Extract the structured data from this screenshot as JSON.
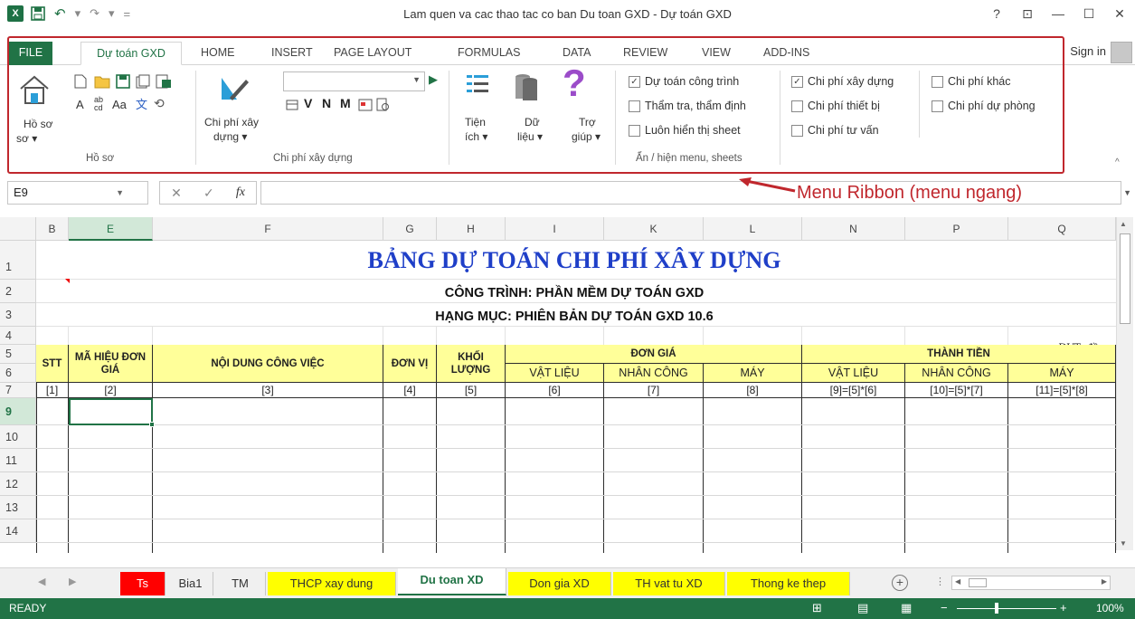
{
  "window": {
    "title": "Lam quen va cac thao tac co ban Du toan GXD - Dự toán GXD",
    "help": "?",
    "controls": [
      "⊡",
      "—",
      "☐",
      "✕"
    ]
  },
  "tabs": {
    "file": "FILE",
    "items": [
      "Dự toán GXD",
      "HOME",
      "INSERT",
      "PAGE LAYOUT",
      "FORMULAS",
      "DATA",
      "REVIEW",
      "VIEW",
      "ADD-INS"
    ],
    "sign_in": "Sign in"
  },
  "ribbon": {
    "hoso": {
      "btn": "Hồ sơ",
      "group": "Hồ sơ"
    },
    "cpxd": {
      "btn1": "Chi phí xây",
      "btn2": "dựng",
      "group": "Chi phí xây dựng"
    },
    "letters": [
      "V",
      "N",
      "M"
    ],
    "tienich": {
      "l1": "Tiện",
      "l2": "ích"
    },
    "dulieu": {
      "l1": "Dữ",
      "l2": "liệu"
    },
    "trogiup": {
      "l1": "Trợ",
      "l2": "giúp"
    },
    "checks": [
      {
        "label": "Dự toán công trình",
        "checked": true
      },
      {
        "label": "Thẩm tra, thẩm định",
        "checked": false
      },
      {
        "label": "Luôn hiển thị sheet",
        "checked": false
      },
      {
        "label": "Chi phí xây dựng",
        "checked": true
      },
      {
        "label": "Chi phí thiết bị",
        "checked": false
      },
      {
        "label": "Chi phí tư vấn",
        "checked": false
      },
      {
        "label": "Chi phí khác",
        "checked": false
      },
      {
        "label": "Chi phí dự phòng",
        "checked": false
      }
    ],
    "show_group": "Ẩn / hiện menu, sheets"
  },
  "formula_bar": {
    "name_box": "E9",
    "fx": "fx",
    "value": ""
  },
  "annotation": "Menu Ribbon (menu ngang)",
  "columns": [
    "B",
    "E",
    "F",
    "G",
    "H",
    "I",
    "K",
    "L",
    "N",
    "P",
    "Q"
  ],
  "rows": [
    "1",
    "2",
    "3",
    "4",
    "5",
    "6",
    "7",
    "9",
    "10",
    "11",
    "12",
    "13",
    "14"
  ],
  "sheet": {
    "title": "BẢNG DỰ TOÁN CHI PHÍ XÂY DỰNG",
    "project": "CÔNG TRÌNH: PHẦN MỀM DỰ TOÁN GXD",
    "item": "HẠNG MỤC: PHIÊN BẢN DỰ TOÁN GXD 10.6",
    "unit": "ĐVT: đồng",
    "headers": {
      "stt": "STT",
      "ma_hieu": "MÃ HIỆU ĐƠN GIÁ",
      "noi_dung": "NỘI DUNG CÔNG VIỆC",
      "don_vi": "ĐƠN VỊ",
      "khoi_luong": "KHỐI LƯỢNG",
      "don_gia": "ĐƠN GIÁ",
      "thanh_tien": "THÀNH TIỀN",
      "vat_lieu": "VẬT LIỆU",
      "nhan_cong": "NHÂN CÔNG",
      "may": "MÁY"
    },
    "index_row": [
      "[1]",
      "[2]",
      "[3]",
      "[4]",
      "[5]",
      "[6]",
      "[7]",
      "[8]",
      "[9]=[5]*[6]",
      "[10]=[5]*[7]",
      "[11]=[5]*[8]"
    ]
  },
  "sheet_tabs": [
    {
      "label": "Ts",
      "color": "#ff0000"
    },
    {
      "label": "Bia1",
      "color": ""
    },
    {
      "label": "TM",
      "color": ""
    },
    {
      "label": "THCP xay dung",
      "color": "#ffff00"
    },
    {
      "label": "Du toan XD",
      "color": "active"
    },
    {
      "label": "Don gia XD",
      "color": "#ffff00"
    },
    {
      "label": "TH vat tu XD",
      "color": "#ffff00"
    },
    {
      "label": "Thong ke thep",
      "color": "#ffff00"
    }
  ],
  "status": {
    "mode": "READY",
    "zoom": "100%"
  }
}
